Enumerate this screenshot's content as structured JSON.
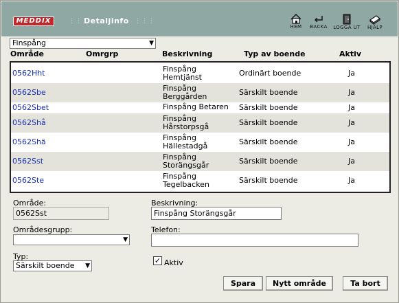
{
  "header": {
    "logo_text": "MEDDIX",
    "page_title": "Detaljinfo",
    "toolbar": [
      {
        "name": "home",
        "label": "HEM",
        "icon": "home-icon"
      },
      {
        "name": "back",
        "label": "BACKA",
        "icon": "back-arrow-icon"
      },
      {
        "name": "logout",
        "label": "LOGGA UT",
        "icon": "door-icon"
      },
      {
        "name": "help",
        "label": "HJÄLP",
        "icon": "book-icon"
      }
    ]
  },
  "filter": {
    "selected": "Finspång"
  },
  "columns": {
    "omrade": "Område",
    "omrgrp": "Omrgrp",
    "beskrivning": "Beskrivning",
    "typ": "Typ av boende",
    "aktiv": "Aktiv"
  },
  "rows": [
    {
      "code": "0562Hht",
      "desc1": "Finspång",
      "desc2": "Hemtjänst",
      "typ": "Ordinärt boende",
      "aktiv": "Ja"
    },
    {
      "code": "0562Sbe",
      "desc1": "Finspång",
      "desc2": "Berggården",
      "typ": "Särskilt boende",
      "aktiv": "Ja"
    },
    {
      "code": "0562Sbet",
      "desc1": "Finspång Betaren",
      "desc2": "",
      "typ": "Särskilt boende",
      "aktiv": "Ja"
    },
    {
      "code": "0562Shå",
      "desc1": "Finspång",
      "desc2": "Hårstorpsgå",
      "typ": "Särskilt boende",
      "aktiv": "Ja"
    },
    {
      "code": "0562Shä",
      "desc1": "Finspång",
      "desc2": "Hällestadgå",
      "typ": "Särskilt boende",
      "aktiv": "Ja"
    },
    {
      "code": "0562Sst",
      "desc1": "Finspång",
      "desc2": "Storängsgår",
      "typ": "Särskilt boende",
      "aktiv": "Ja"
    },
    {
      "code": "0562Ste",
      "desc1": "Finspång",
      "desc2": "Tegelbacken",
      "typ": "Särskilt boende",
      "aktiv": "Ja"
    }
  ],
  "form": {
    "omrade_label": "Område:",
    "omrade_value": "0562Sst",
    "beskrivning_label": "Beskrivning:",
    "beskrivning_value": "Finspång Storängsgår",
    "omradesgrupp_label": "Områdesgrupp:",
    "omradesgrupp_value": "",
    "telefon_label": "Telefon:",
    "telefon_value": "",
    "typ_label": "Typ:",
    "typ_value": "Särskilt boende",
    "aktiv_label": "Aktiv",
    "aktiv_checked": true
  },
  "buttons": {
    "save": "Spara",
    "new_area": "Nytt område",
    "delete": "Ta bort"
  },
  "colors": {
    "header_bg": "#8fa8a4",
    "logo_bg": "#c0282a",
    "link": "#1a2fb0",
    "alt_row": "#e3e3dc"
  }
}
